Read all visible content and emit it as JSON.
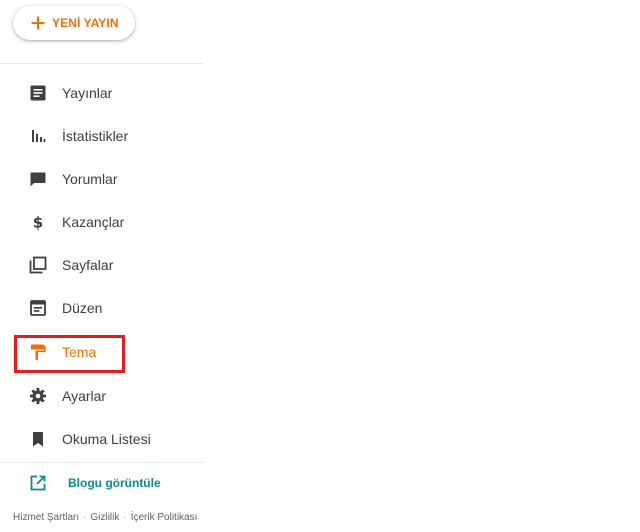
{
  "new_post": {
    "label": "YENİ YAYIN"
  },
  "nav": {
    "items": [
      {
        "label": "Yayınlar",
        "icon": "posts-icon"
      },
      {
        "label": "İstatistikler",
        "icon": "stats-icon"
      },
      {
        "label": "Yorumlar",
        "icon": "comments-icon"
      },
      {
        "label": "Kazançlar",
        "icon": "dollar-icon"
      },
      {
        "label": "Sayfalar",
        "icon": "pages-icon"
      },
      {
        "label": "Düzen",
        "icon": "layout-icon"
      },
      {
        "label": "Tema",
        "icon": "paint-roller-icon",
        "active": true
      },
      {
        "label": "Ayarlar",
        "icon": "gear-icon"
      },
      {
        "label": "Okuma Listesi",
        "icon": "bookmark-icon"
      }
    ]
  },
  "view_blog": {
    "label": "Blogu görüntüle"
  },
  "footer": {
    "links": [
      "Hizmet Şartları",
      "Gizlilik",
      "İçerik Politikası"
    ],
    "separator": "·"
  },
  "colors": {
    "accent": "#e8710a",
    "text": "#3c4043",
    "icon": "#3c4043",
    "view_blog": "#0b8a8a",
    "highlight": "#e31d1d"
  }
}
